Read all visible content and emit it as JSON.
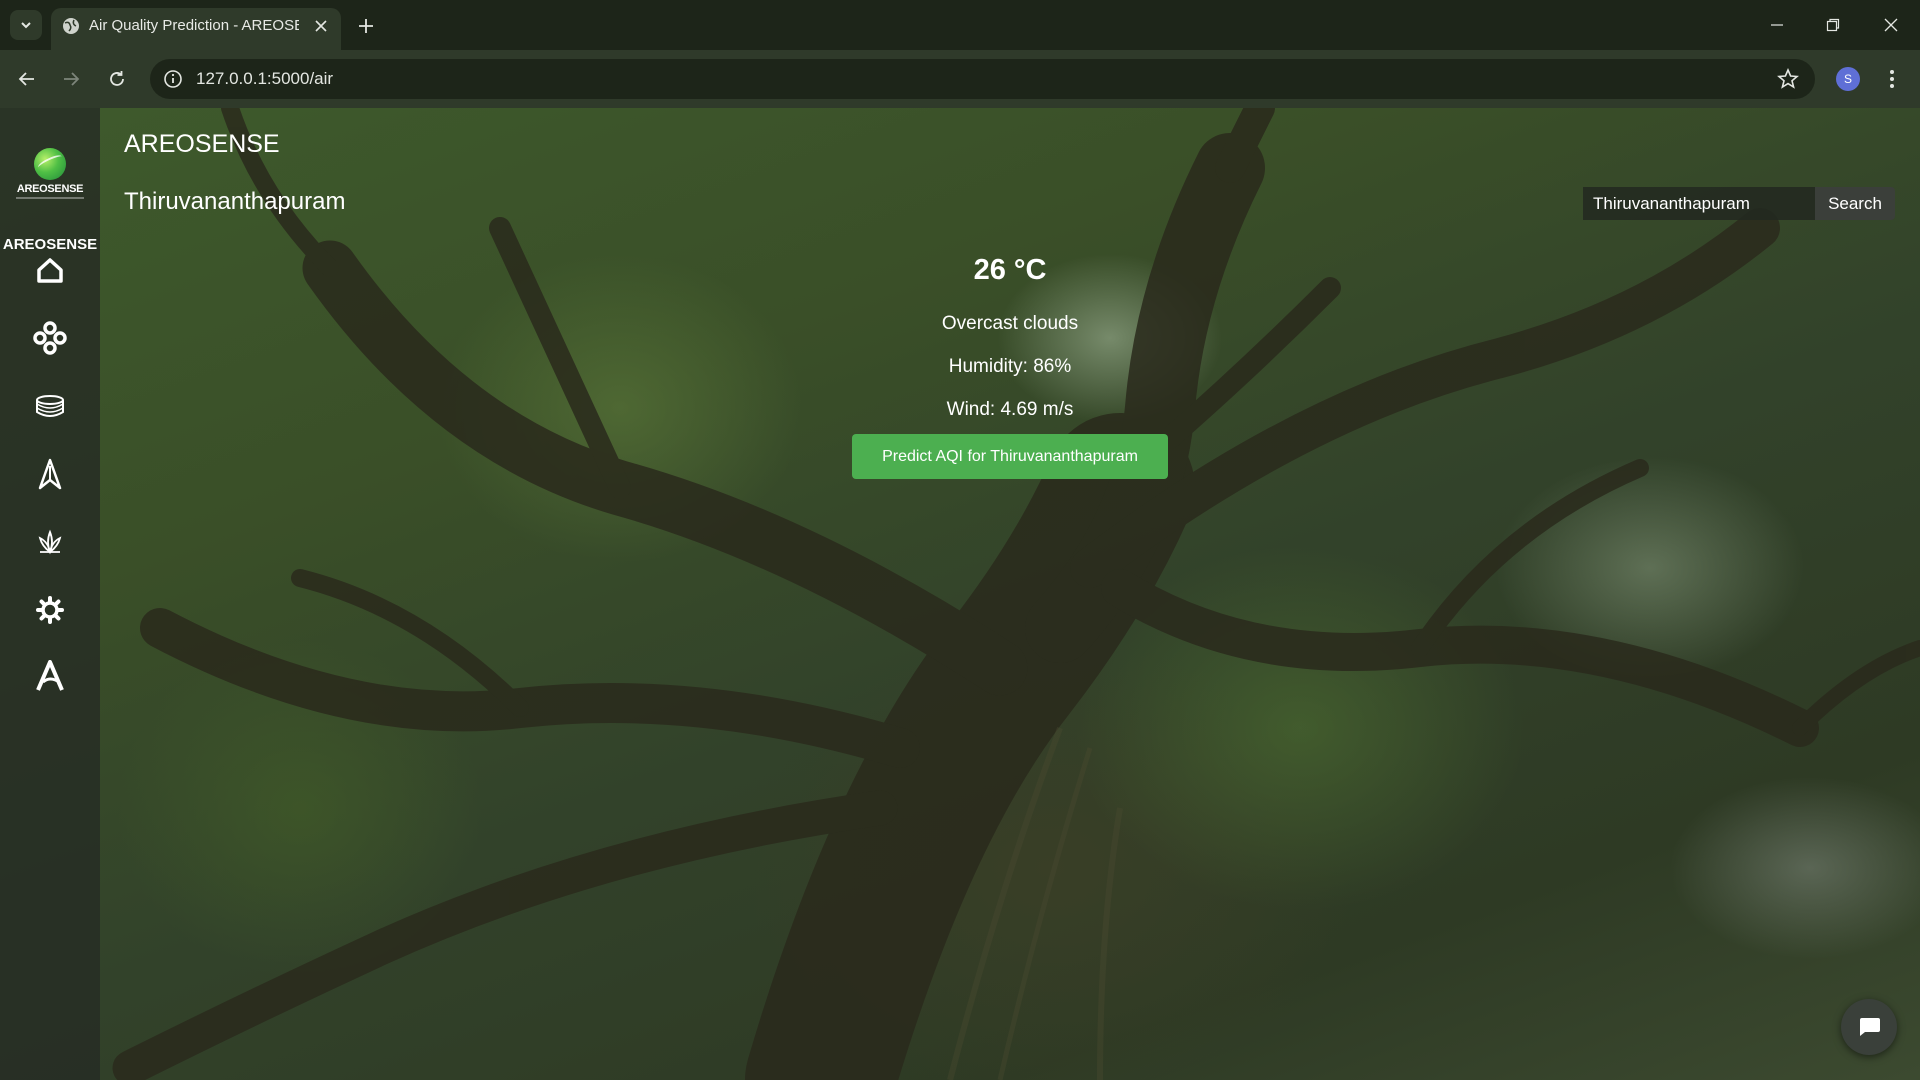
{
  "browser": {
    "tab_title": "Air Quality Prediction - AREOSENSE",
    "url": "127.0.0.1:5000/air",
    "profile_initial": "S"
  },
  "sidebar": {
    "logo_wordmark": "AREOSENSE",
    "brand": "AREOSENSE",
    "items": [
      {
        "icon": "home-icon"
      },
      {
        "icon": "nodes-icon"
      },
      {
        "icon": "database-icon"
      },
      {
        "icon": "navigation-icon"
      },
      {
        "icon": "lotus-icon"
      },
      {
        "icon": "gear-icon"
      },
      {
        "icon": "letter-a-icon"
      }
    ]
  },
  "header": {
    "brand": "AREOSENSE",
    "city": "Thiruvananthapuram"
  },
  "search": {
    "value": "Thiruvananthapuram",
    "button_label": "Search"
  },
  "weather": {
    "temperature": "26 °C",
    "description": "Overcast clouds",
    "humidity": "Humidity: 86%",
    "wind": "Wind: 4.69 m/s"
  },
  "predict": {
    "button_label": "Predict AQI for Thiruvananthapuram",
    "color": "#4caf50"
  },
  "theme": {
    "chrome_dark": "#1d2519",
    "chrome_light": "#2f3a2a"
  }
}
